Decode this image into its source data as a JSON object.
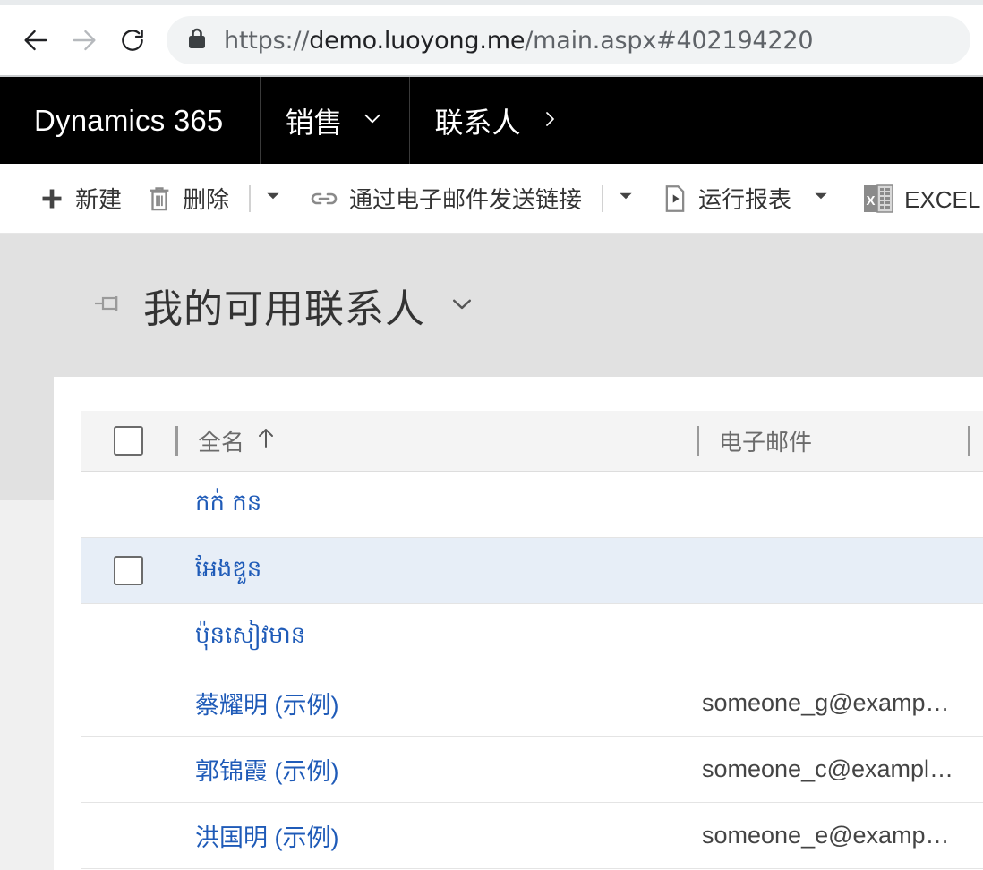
{
  "browser": {
    "back_icon": "arrow-left-icon",
    "forward_icon": "arrow-right-icon",
    "reload_icon": "reload-icon",
    "lock_icon": "lock-icon",
    "url_scheme": "https://",
    "url_host": "demo.luoyong.me",
    "url_path": "/main.aspx#402194220",
    "url_full": "https://demo.luoyong.me/main.aspx#402194220"
  },
  "appbar": {
    "brand": "Dynamics 365",
    "module": "销售",
    "module_caret_icon": "chevron-down-icon",
    "entity": "联系人",
    "entity_caret_icon": "chevron-right-icon"
  },
  "commandbar": {
    "items": [
      {
        "label": "新建",
        "icon": "plus-icon",
        "split": false
      },
      {
        "label": "删除",
        "icon": "trash-icon",
        "split": true
      },
      {
        "label": "通过电子邮件发送链接",
        "icon": "link-icon",
        "split": true
      },
      {
        "label": "运行报表",
        "icon": "report-icon",
        "split": true,
        "split_rule": false
      },
      {
        "label": "EXCEL 模板",
        "icon": "excel-icon",
        "split": false
      }
    ]
  },
  "view": {
    "pin_icon": "pin-icon",
    "title": "我的可用联系人",
    "caret_icon": "chevron-down-icon"
  },
  "grid": {
    "select_all_icon": "checkbox-icon",
    "columns": [
      {
        "label": "全名",
        "sort": "asc",
        "sort_icon": "arrow-up-icon"
      },
      {
        "label": "电子邮件",
        "sort": "none"
      }
    ],
    "rows": [
      {
        "name": "កក់ កន",
        "email": "",
        "script": "khmer",
        "selected": false
      },
      {
        "name": "អែងឌួន",
        "email": "",
        "script": "khmer",
        "selected": true
      },
      {
        "name": "ប៉ុនសៀវមាន",
        "email": "",
        "script": "khmer",
        "selected": false
      },
      {
        "name": "蔡耀明 (示例)",
        "email": "someone_g@examp…",
        "script": "han",
        "selected": false
      },
      {
        "name": "郭锦霞 (示例)",
        "email": "someone_c@exampl…",
        "script": "han",
        "selected": false
      },
      {
        "name": "洪国明 (示例)",
        "email": "someone_e@examp…",
        "script": "han",
        "selected": false
      }
    ]
  },
  "colors": {
    "appbar_bg": "#000000",
    "page_bg": "#e1e1e1",
    "link": "#1f5bb8",
    "row_selected_bg": "#e7eef7",
    "header_bg": "#f4f4f4"
  }
}
